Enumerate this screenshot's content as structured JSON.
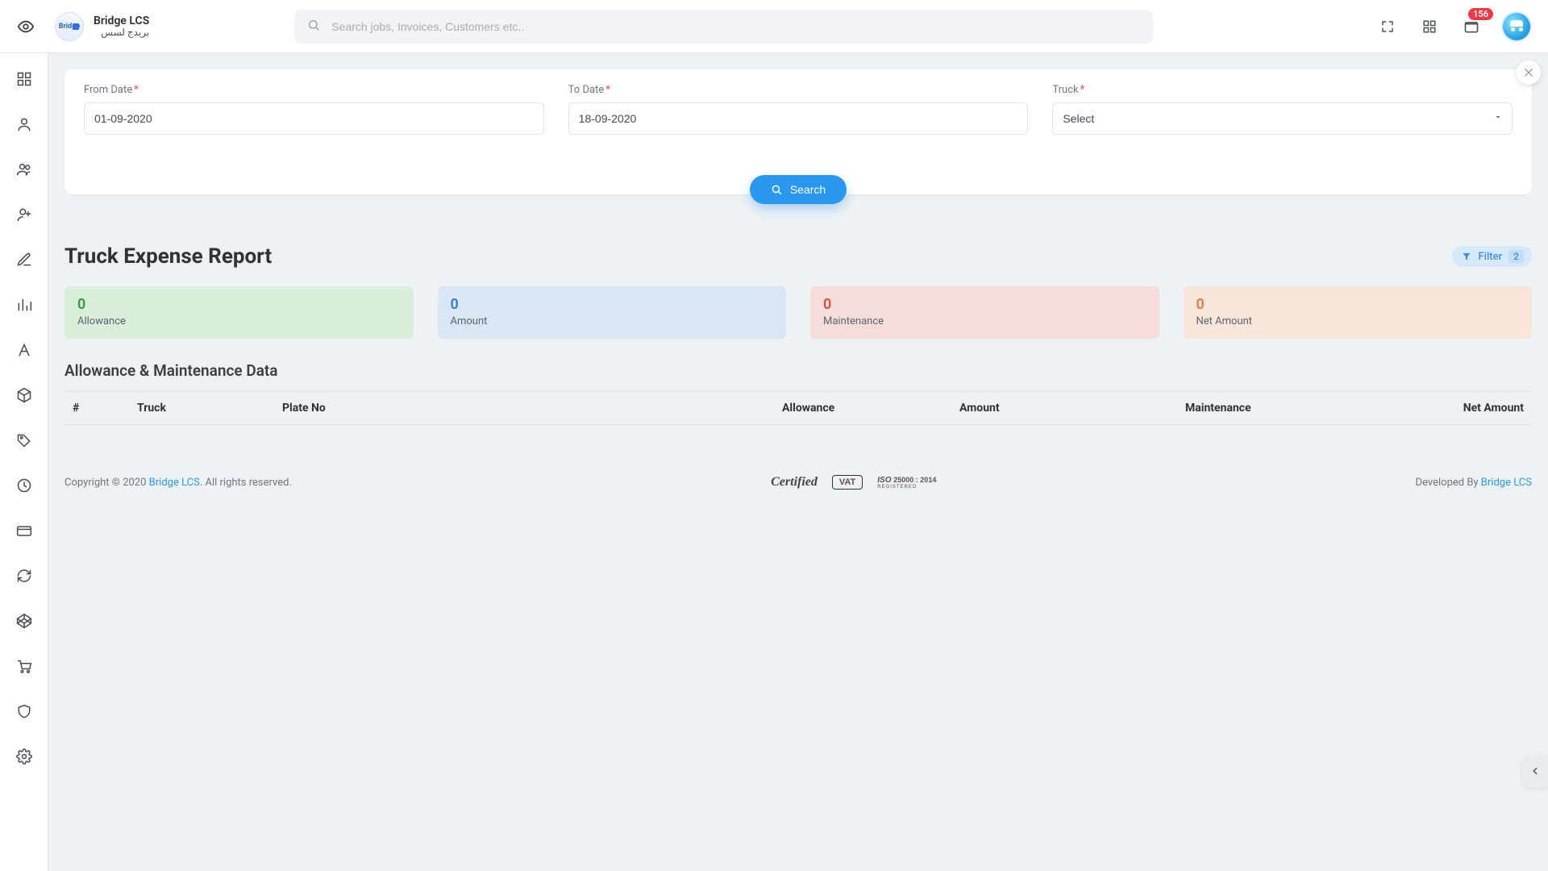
{
  "header": {
    "brand_title": "Bridge LCS",
    "brand_sub": "بريدج لسس",
    "search_placeholder": "Search jobs, Invoices, Customers etc..",
    "notification_count": "156"
  },
  "filter": {
    "from_label": "From Date",
    "from_value": "01-09-2020",
    "to_label": "To Date",
    "to_value": "18-09-2020",
    "truck_label": "Truck",
    "truck_placeholder": "Select",
    "search_btn": "Search"
  },
  "page": {
    "title": "Truck Expense Report",
    "filter_pill_label": "Filter",
    "filter_pill_count": "2",
    "section_title": "Allowance & Maintenance Data"
  },
  "stats": {
    "allowance_value": "0",
    "allowance_label": "Allowance",
    "amount_value": "0",
    "amount_label": "Amount",
    "maintenance_value": "0",
    "maintenance_label": "Maintenance",
    "net_value": "0",
    "net_label": "Net Amount"
  },
  "table": {
    "cols": {
      "idx": "#",
      "truck": "Truck",
      "plate": "Plate No",
      "allowance": "Allowance",
      "amount": "Amount",
      "maintenance": "Maintenance",
      "net": "Net Amount"
    },
    "rows": []
  },
  "footer": {
    "copyright_pre": "Copyright © 2020 ",
    "copyright_link": "Bridge LCS",
    "copyright_post": ". All rights reserved.",
    "certified": "Certified",
    "vat": "VAT",
    "iso": "ISO 25000 : 2014",
    "iso_sub": "REGISTERED",
    "dev_pre": "Developed By ",
    "dev_link": "Bridge LCS"
  }
}
